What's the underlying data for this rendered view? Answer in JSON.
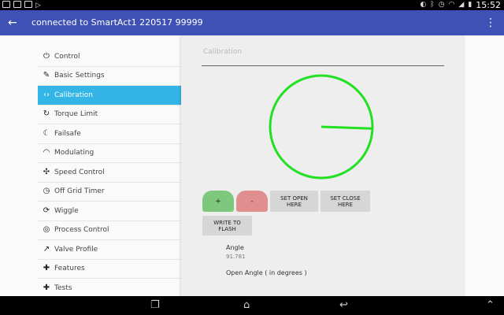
{
  "status_bar": {
    "time": "15:52",
    "icons_left": [
      "image-icon",
      "message-icon",
      "calendar-icon",
      "play-store-icon"
    ],
    "icons_right": [
      "nfc-icon",
      "bluetooth-icon",
      "alarm-icon",
      "wifi-icon",
      "signal-icon",
      "battery-icon"
    ]
  },
  "app_bar": {
    "title": "connected to SmartAct1 220517 99999"
  },
  "sidebar": {
    "items": [
      {
        "label": "Control",
        "icon": "power-icon",
        "active": false
      },
      {
        "label": "Basic Settings",
        "icon": "wrench-icon",
        "active": false
      },
      {
        "label": "Calibration",
        "icon": "code-icon",
        "active": true
      },
      {
        "label": "Torque Limit",
        "icon": "rotate-icon",
        "active": false
      },
      {
        "label": "Failsafe",
        "icon": "moon-icon",
        "active": false
      },
      {
        "label": "Modulating",
        "icon": "signal-wave-icon",
        "active": false
      },
      {
        "label": "Speed Control",
        "icon": "fan-icon",
        "active": false
      },
      {
        "label": "Off Grid Timer",
        "icon": "clock-icon",
        "active": false
      },
      {
        "label": "Wiggle",
        "icon": "refresh-icon",
        "active": false
      },
      {
        "label": "Process Control",
        "icon": "target-icon",
        "active": false
      },
      {
        "label": "Valve Profile",
        "icon": "trending-icon",
        "active": false
      },
      {
        "label": "Features",
        "icon": "puzzle-icon",
        "active": false
      },
      {
        "label": "Tests",
        "icon": "puzzle-icon",
        "active": false
      }
    ]
  },
  "panel": {
    "heading": "Calibration",
    "dial": {
      "color": "#22e022",
      "needle_angle_deg": -2
    },
    "buttons": {
      "plus": "+",
      "minus": "-",
      "set_open": "SET OPEN HERE",
      "set_close": "SET CLOSE HERE",
      "write_flash": "WRITE TO FLASH"
    },
    "fields": [
      {
        "label": "Angle",
        "value": "91.781"
      },
      {
        "label": "Open Angle ( in degrees )",
        "value": ""
      }
    ]
  },
  "colors": {
    "app_bar": "#3f51b5",
    "active_item": "#33b5e5",
    "plus_button": "#7ec87e",
    "minus_button": "#e08e8e"
  }
}
